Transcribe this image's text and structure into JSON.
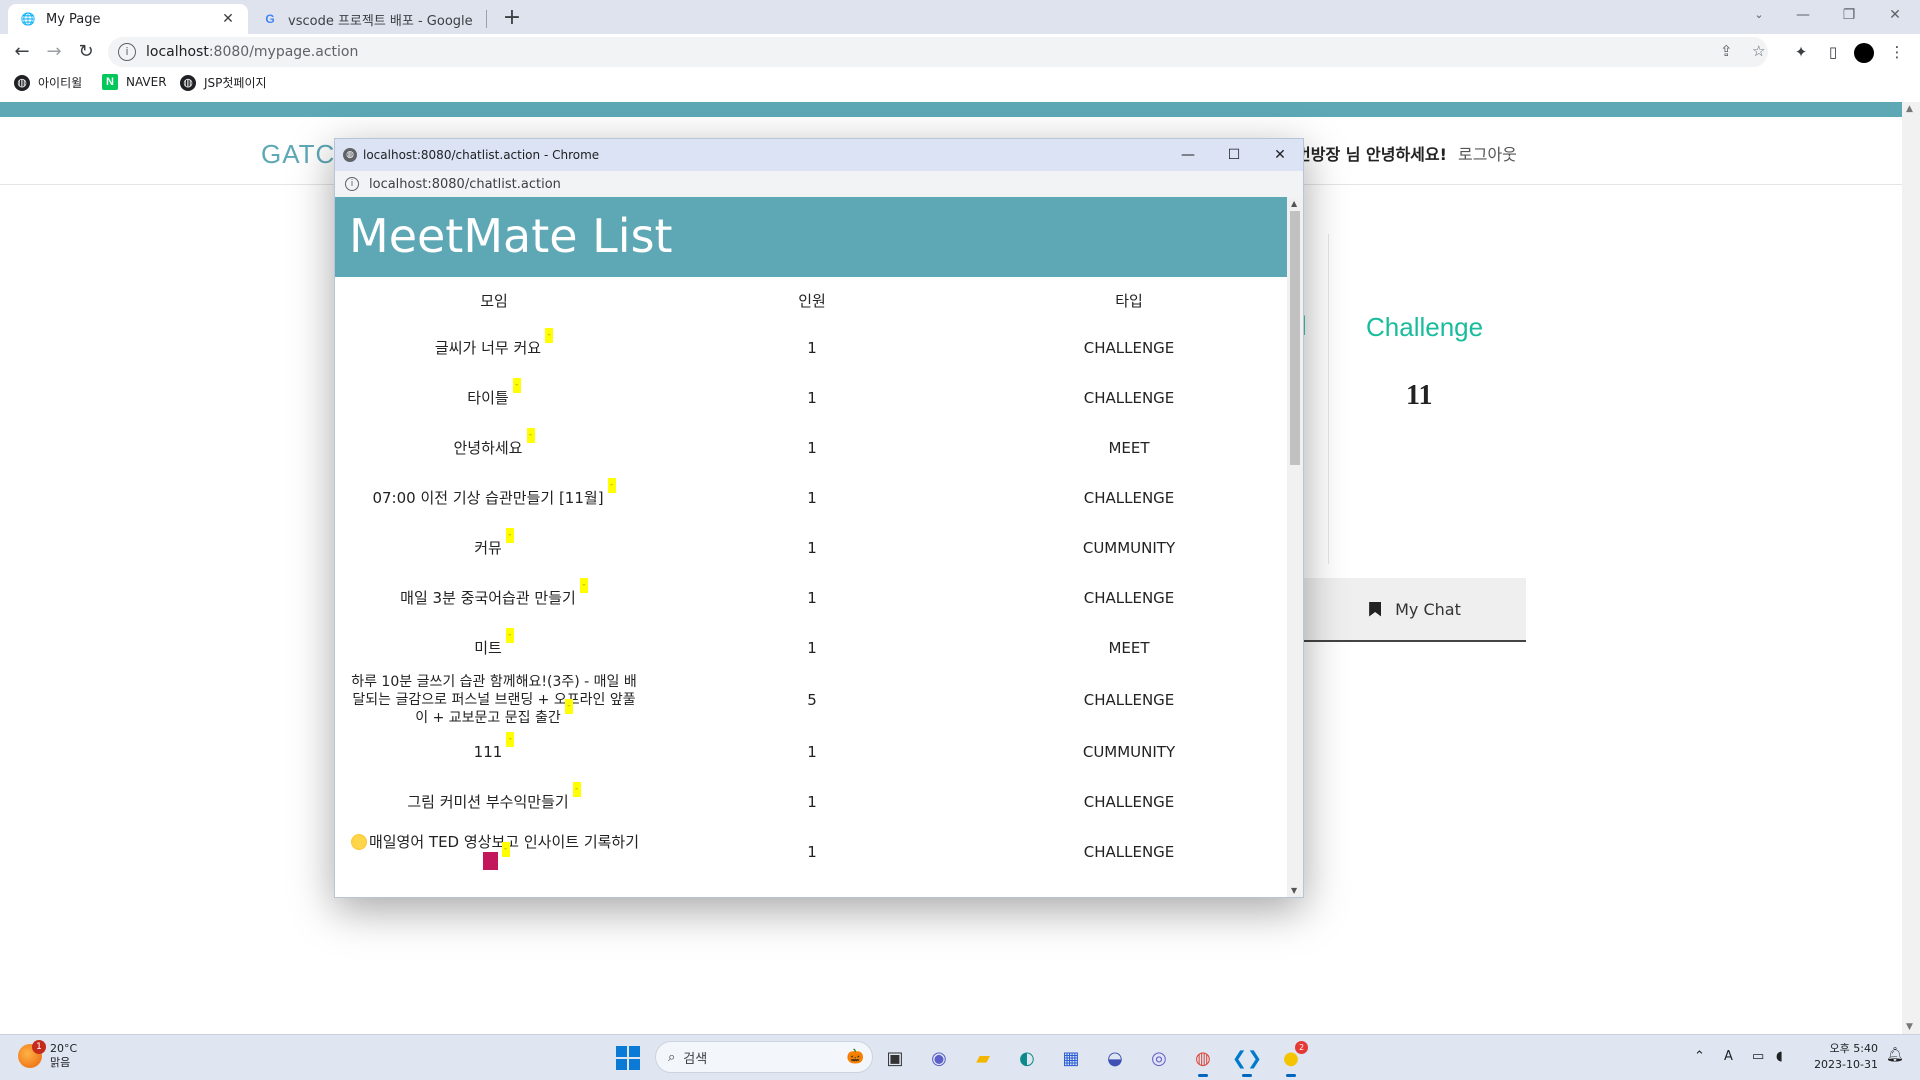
{
  "browser": {
    "tabs": [
      {
        "title": "My Page",
        "active": true
      },
      {
        "title": "vscode 프로젝트 배포 - Google",
        "active": false
      }
    ],
    "new_tab": "+",
    "address": {
      "host": "localhost",
      "path": ":8080/mypage.action"
    },
    "bookmarks": [
      {
        "label": "아이티윌"
      },
      {
        "label": "NAVER"
      },
      {
        "label": "JSP첫페이지"
      }
    ]
  },
  "page": {
    "logo": "GATC",
    "greeting": "번방장 님 안녕하세요!",
    "logout": "로그아웃",
    "challenge_label": "Challenge",
    "challenge_count": "11",
    "my_chat": "My Chat"
  },
  "popup": {
    "title": "localhost:8080/chatlist.action - Chrome",
    "url": "localhost:8080/chatlist.action",
    "heading": "MeetMate List",
    "columns": [
      "모임",
      "인원",
      "타입"
    ],
    "rows": [
      {
        "name": "글씨가 너무 커요",
        "count": "1",
        "type": "CHALLENGE"
      },
      {
        "name": "타이틀",
        "count": "1",
        "type": "CHALLENGE"
      },
      {
        "name": "안녕하세요",
        "count": "1",
        "type": "MEET"
      },
      {
        "name": "07:00 이전 기상 습관만들기 [11월]",
        "count": "1",
        "type": "CHALLENGE"
      },
      {
        "name": "커뮤",
        "count": "1",
        "type": "CUMMUNITY"
      },
      {
        "name": "매일 3분 중국어습관 만들기",
        "count": "1",
        "type": "CHALLENGE"
      },
      {
        "name": "미트",
        "count": "1",
        "type": "MEET"
      },
      {
        "name": "하루 10분 글쓰기 습관 함께해요!(3주) - 매일 배달되는 글감으로 퍼스널 브랜딩 + 오프라인 앞풀이 + 교보문고 문집 출간",
        "count": "5",
        "type": "CHALLENGE"
      },
      {
        "name": "111",
        "count": "1",
        "type": "CUMMUNITY"
      },
      {
        "name": "그림 커미션 부수익만들기",
        "count": "1",
        "type": "CHALLENGE"
      },
      {
        "name": "매일영어 TED 영상보고 인사이트 기록하기",
        "count": "1",
        "type": "CHALLENGE"
      }
    ]
  },
  "taskbar": {
    "weather_temp": "20°C",
    "weather_desc": "맑음",
    "weather_badge": "1",
    "search_placeholder": "검색",
    "time": "오후 5:40",
    "date": "2023-10-31",
    "chat_badge": "2"
  },
  "colors": {
    "accent": "#5ea8b6",
    "challenge": "#19bc9c",
    "new_badge": "#ffff00"
  }
}
